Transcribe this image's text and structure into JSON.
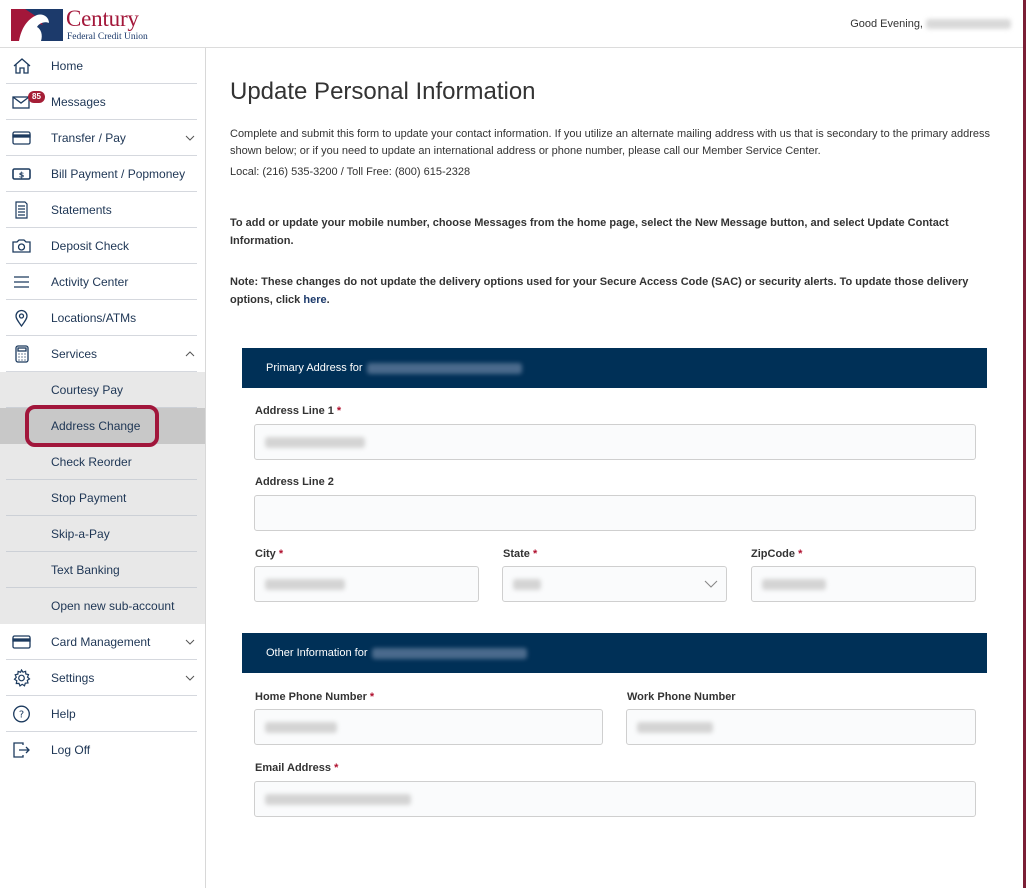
{
  "header": {
    "logo_name": "Century",
    "logo_sub": "Federal Credit Union",
    "greeting": "Good Evening,"
  },
  "sidebar": {
    "items": [
      {
        "label": "Home",
        "icon": "home-icon"
      },
      {
        "label": "Messages",
        "icon": "envelope-icon",
        "badge": "85"
      },
      {
        "label": "Transfer / Pay",
        "icon": "credit-card-icon",
        "expandable": true
      },
      {
        "label": "Bill Payment / Popmoney",
        "icon": "money-icon"
      },
      {
        "label": "Statements",
        "icon": "document-icon"
      },
      {
        "label": "Deposit Check",
        "icon": "camera-icon"
      },
      {
        "label": "Activity Center",
        "icon": "menu-lines-icon"
      },
      {
        "label": "Locations/ATMs",
        "icon": "map-pin-icon"
      },
      {
        "label": "Services",
        "icon": "calculator-icon",
        "expanded": true
      }
    ],
    "services_sub": [
      {
        "label": "Courtesy Pay"
      },
      {
        "label": "Address Change",
        "active": true
      },
      {
        "label": "Check Reorder"
      },
      {
        "label": "Stop Payment"
      },
      {
        "label": "Skip-a-Pay"
      },
      {
        "label": "Text Banking"
      },
      {
        "label": "Open new sub-account"
      }
    ],
    "bottom_items": [
      {
        "label": "Card Management",
        "icon": "credit-card-icon",
        "expandable": true
      },
      {
        "label": "Settings",
        "icon": "gear-icon",
        "expandable": true
      },
      {
        "label": "Help",
        "icon": "help-icon"
      },
      {
        "label": "Log Off",
        "icon": "logout-icon"
      }
    ]
  },
  "main": {
    "title": "Update Personal Information",
    "intro": "Complete and submit this form to update your contact information. If you utilize an alternate mailing address with us that is secondary to the primary address shown below; or if you need to update an international address or phone number, please call our Member Service Center.",
    "phones": "Local: (216) 535-3200 / Toll Free: (800) 615-2328",
    "note_mobile": "To add or update your mobile number, choose Messages from the home page, select the New Message button, and select Update Contact Information.",
    "note_sac_prefix": "Note: These changes do not update the delivery options used for your Secure Access Code (SAC) or security alerts. To update those delivery options, click ",
    "note_sac_link": "here",
    "note_sac_suffix": ".",
    "primary_section": {
      "title": "Primary Address for",
      "fields": {
        "address1_label": "Address Line 1",
        "address2_label": "Address Line 2",
        "city_label": "City",
        "state_label": "State",
        "zip_label": "ZipCode"
      }
    },
    "other_section": {
      "title": "Other Information for",
      "fields": {
        "home_phone_label": "Home Phone Number",
        "work_phone_label": "Work Phone Number",
        "email_label": "Email Address"
      }
    },
    "required_mark": "*"
  },
  "colors": {
    "brand_red": "#a3173a",
    "navy": "#003057",
    "nav_text": "#1d3554",
    "highlight": "#a1163b"
  }
}
